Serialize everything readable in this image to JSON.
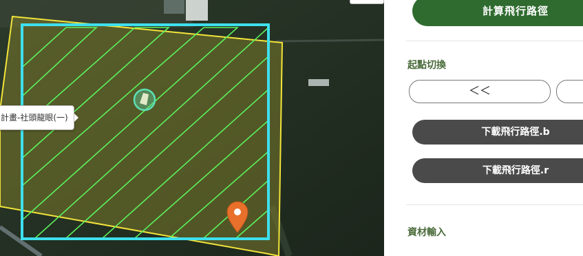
{
  "map": {
    "tooltip_label": "計畫-社頭龍眼(一)",
    "colors": {
      "field_outline": "#f3e53a",
      "flight_area": "#3ee0ee",
      "flight_lines": "#5cf25c",
      "marker": "#e8702a",
      "start_circle": "#5de0b6"
    },
    "icons": {
      "marker": "map-pin-icon",
      "start": "start-point-icon"
    }
  },
  "panel": {
    "compute_button": "計算飛行路徑",
    "start_switch_title": "起點切換",
    "prev_button": "＜＜",
    "next_button": "",
    "download_b_button": "下載飛行路徑.b",
    "download_r_button": "下載飛行路徑.r",
    "materials_title": "資材輸入"
  },
  "colors": {
    "primary": "#2f6b2f",
    "dark_button": "#4a4a4a",
    "section_title": "#4a6b3a"
  }
}
